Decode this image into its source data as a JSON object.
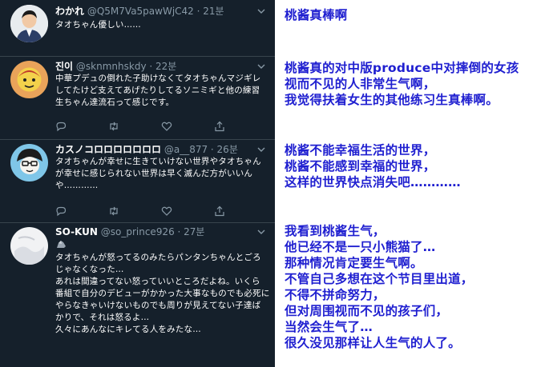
{
  "tweets": [
    {
      "name": "わかれ",
      "meta": "@Q5M7Va5pawWjC42 · 21분",
      "lines": [
        "タオちゃん優しい……"
      ]
    },
    {
      "name": "진이",
      "meta": "@sknmnhskdy · 22분",
      "lines": [
        "中華プデュの倒れた子助けなくてタオちゃんマジギレ",
        "してたけど支えてあげたりしてるソニミギと他の練習",
        "生ちゃん達流石って感じです。"
      ]
    },
    {
      "name": "カスノコロロロロロロロ",
      "meta": "@a__877 · 26분",
      "lines": [
        "タオちゃんが幸せに生きていけない世界やタオちゃん",
        "が幸せに感じられない世界は早く滅んだ方がいいん",
        "や…………"
      ]
    },
    {
      "name": "SO-KUN",
      "meta": "@so_prince926 · 27분",
      "lines": [
        "タオちゃんが怒ってるのみたらパンタンちゃんとごろ",
        "じゃなくなった…",
        "あれは間違ってない怒っていいところだよね。いくら",
        "番組で自分のデビューがかかった大事なものでも必死に",
        "やらなきゃいけないものでも周りが見えてない子達ば",
        "かりで、それは怒るよ…",
        "久々にあんなにキレてる人をみたな…"
      ]
    }
  ],
  "notes": [
    [
      "桃酱真棒啊"
    ],
    [
      "桃酱真的对中版produce中对摔倒的女孩",
      "视而不见的人非常生气啊，",
      "我觉得扶着女生的其他练习生真棒啊。"
    ],
    [
      "桃酱不能幸福生活的世界，",
      "桃酱不能感到幸福的世界，",
      "这样的世界快点消失吧…………"
    ],
    [
      "我看到桃酱生气，",
      "他已经不是一只小熊猫了…",
      "那种情况肯定要生气啊。",
      "不管自己多想在这个节目里出道，",
      "不得不拼命努力，",
      "但对周围视而不见的孩子们，",
      "当然会生气了…",
      "很久没见那样让人生气的人了。"
    ]
  ],
  "colors": {
    "background": "#15202b",
    "divider": "#38444d",
    "meta": "#8899a6",
    "note": "#1f1fd0"
  },
  "icons": [
    "reply-icon",
    "retweet-icon",
    "like-icon",
    "share-icon",
    "chevron-down-icon"
  ]
}
